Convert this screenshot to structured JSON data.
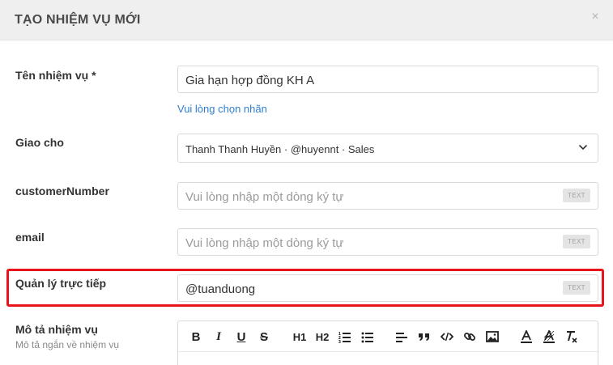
{
  "modal": {
    "title": "TẠO NHIỆM VỤ MỚI",
    "close_glyph": "×"
  },
  "fields": {
    "task_name": {
      "label": "Tên nhiệm vụ *",
      "value": "Gia hạn hợp đồng KH A",
      "hint": "Vui lòng chọn nhãn"
    },
    "assignee": {
      "label": "Giao cho",
      "value": "Thanh Thanh Huyền · @huyennt · Sales"
    },
    "customer_number": {
      "label": "customerNumber",
      "placeholder": "Vui lòng nhập một dòng ký tự",
      "badge": "TEXT"
    },
    "email": {
      "label": "email",
      "placeholder": "Vui lòng nhập một dòng ký tự",
      "badge": "TEXT"
    },
    "direct_manager": {
      "label": "Quản lý trực tiếp",
      "value": "@tuanduong",
      "badge": "TEXT"
    },
    "description": {
      "label": "Mô tả nhiệm vụ",
      "sublabel": "Mô tả ngắn về nhiệm vụ"
    }
  },
  "editor_toolbar": {
    "bold": "B",
    "italic": "I",
    "underline": "U",
    "strike": "S",
    "h1": "H1",
    "h2": "H2"
  },
  "colors": {
    "highlight": "#e8131b",
    "link": "#2f7fd1",
    "header_bg": "#efefef"
  }
}
